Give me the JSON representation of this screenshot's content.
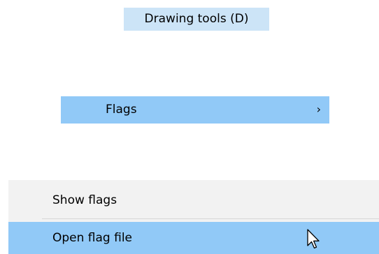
{
  "tooltip": {
    "text": "Drawing tools (D)"
  },
  "menu": {
    "flags_label": "Flags",
    "flags_chevron": "›"
  },
  "submenu": {
    "items": [
      {
        "label": "Show flags",
        "highlighted": false
      },
      {
        "label": "Open flag file",
        "highlighted": true
      }
    ]
  },
  "colors": {
    "tooltip_bg": "#cce4f7",
    "highlight": "#91c9f7",
    "menu_bg": "#f2f2f2",
    "separator": "#d7d7d7"
  },
  "icons": {
    "pointer": "mouse-pointer-icon"
  }
}
